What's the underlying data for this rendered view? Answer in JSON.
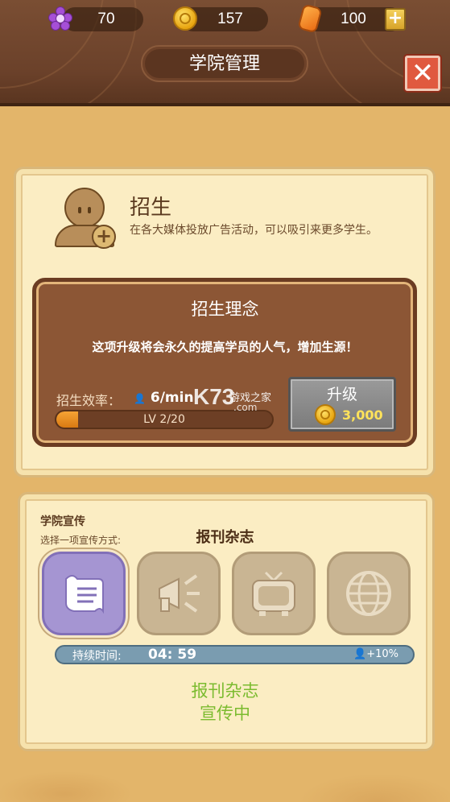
{
  "resources": {
    "flowers": "70",
    "coins": "157",
    "gems": "100"
  },
  "header": {
    "title": "学院管理",
    "close_icon": "close-icon"
  },
  "recruit": {
    "title": "招生",
    "description": "在各大媒体投放广告活动，可以吸引来更多学生。",
    "concept": {
      "title": "招生理念",
      "description": "这项升级将会永久的提高学员的人气，增加生源！",
      "rate_label": "招生效率：",
      "rate_value": "6/min",
      "level_text": "LV 2/20",
      "level_progress": 0.1,
      "upgrade_label": "升级",
      "upgrade_cost": "3,000"
    }
  },
  "watermark": {
    "logo": "K73",
    "site_name": "游戏之家",
    "domain": ".com"
  },
  "promotion": {
    "title": "学院宣传",
    "subtitle": "选择一项宣传方式:",
    "selected_mode": "报刊杂志",
    "options": [
      {
        "icon": "newspaper-icon",
        "selected": true
      },
      {
        "icon": "megaphone-icon",
        "selected": false
      },
      {
        "icon": "tv-icon",
        "selected": false
      },
      {
        "icon": "globe-icon",
        "selected": false
      }
    ],
    "duration_label": "持续时间:",
    "duration_value": "04: 59",
    "bonus": "+10%",
    "status_line1": "报刊杂志",
    "status_line2": "宣传中"
  },
  "colors": {
    "accent_green": "#7bbb2f",
    "selected_option": "#a595d2",
    "close_red": "#e0593f"
  }
}
